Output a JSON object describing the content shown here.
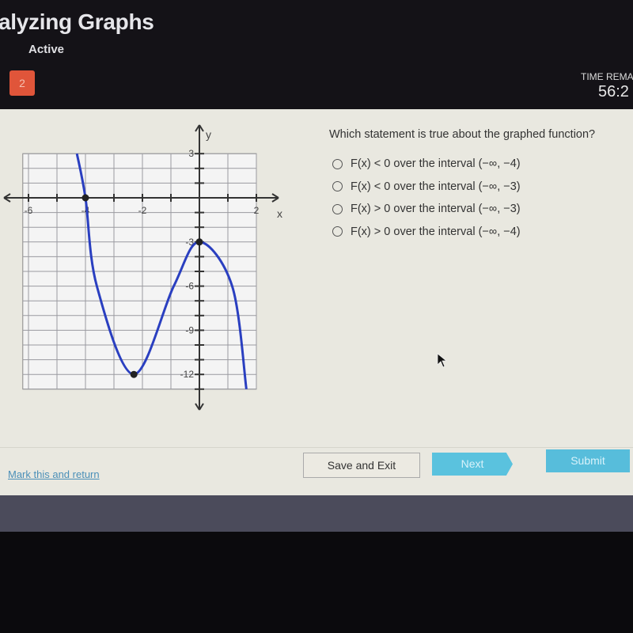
{
  "header": {
    "title": "alyzing Graphs",
    "status": "Active",
    "question_number": "2",
    "time_label": "TIME REMAI",
    "time_value": "56:2"
  },
  "question": {
    "prompt": "Which statement is true about the graphed function?",
    "options": [
      {
        "label": "F(x) < 0 over the interval (−∞, −4)",
        "selected": false
      },
      {
        "label": "F(x) < 0 over the interval (−∞, −3)",
        "selected": false
      },
      {
        "label": "F(x) > 0 over the interval (−∞, −3)",
        "selected": false
      },
      {
        "label": "F(x) > 0 over the interval (−∞, −4)",
        "selected": false
      }
    ]
  },
  "footer": {
    "mark_link": "Mark this and return",
    "save_exit": "Save and Exit",
    "next": "Next",
    "submit": "Submit"
  },
  "colors": {
    "curve": "#2a3fc0",
    "accent": "#5ac2de",
    "question_badge": "#e0553a"
  },
  "chart_data": {
    "type": "line",
    "xlabel": "x",
    "ylabel": "y",
    "xlim": [
      -6.2,
      2
    ],
    "ylim": [
      -13,
      3
    ],
    "grid": true,
    "x_ticks": [
      {
        "v": -6,
        "label": "-6"
      },
      {
        "v": -4,
        "label": "-4"
      },
      {
        "v": -2,
        "label": "-2"
      },
      {
        "v": 2,
        "label": "2"
      }
    ],
    "y_ticks": [
      {
        "v": 3,
        "label": "3"
      },
      {
        "v": -3,
        "label": "-3"
      },
      {
        "v": -6,
        "label": "-6"
      },
      {
        "v": -9,
        "label": "-9"
      },
      {
        "v": -12,
        "label": "-12"
      }
    ],
    "curve": [
      [
        -4.3,
        3
      ],
      [
        -4,
        0
      ],
      [
        -3.6,
        -6
      ],
      [
        -2.3,
        -12
      ],
      [
        -0.9,
        -6
      ],
      [
        0,
        -3
      ],
      [
        1.15,
        -6
      ],
      [
        1.65,
        -13
      ]
    ],
    "marked_points": [
      [
        -4,
        0
      ],
      [
        -2.3,
        -12
      ],
      [
        0,
        -3
      ]
    ]
  }
}
